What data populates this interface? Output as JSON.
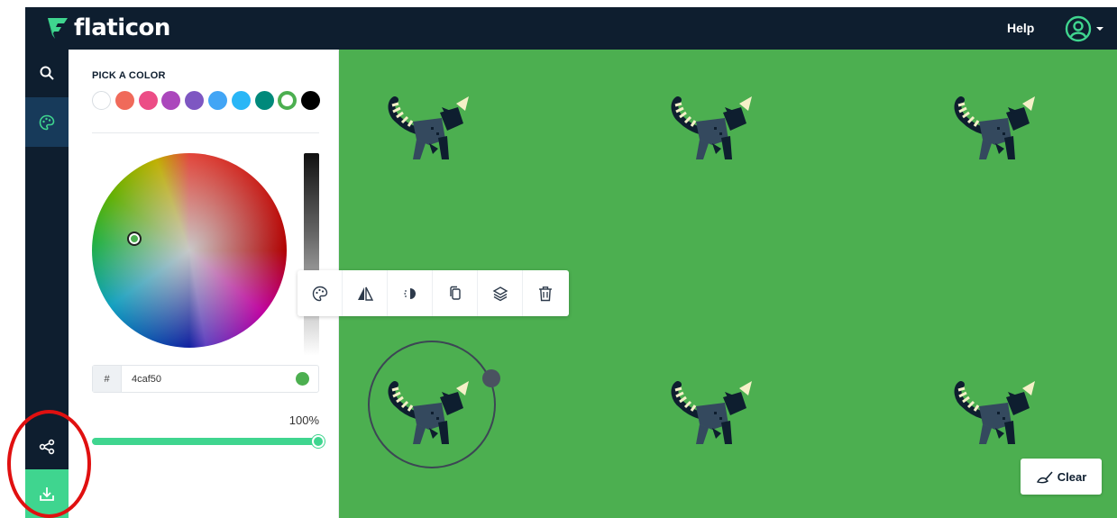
{
  "header": {
    "logo_text": "flaticon",
    "help_label": "Help",
    "user_icon": "user-circle-icon",
    "colors": {
      "bar": "#0e1e2f",
      "logo_mark": "#3fd58f"
    }
  },
  "sidebar": {
    "items": [
      {
        "name": "search",
        "icon": "search-icon"
      },
      {
        "name": "color",
        "icon": "palette-icon",
        "active": true
      },
      {
        "name": "share",
        "icon": "share-icon"
      },
      {
        "name": "download",
        "icon": "download-icon"
      }
    ]
  },
  "color_panel": {
    "title": "PICK A COLOR",
    "swatches": [
      "#ffffff",
      "#f06a5a",
      "#ec4d86",
      "#ab47bc",
      "#7e57c2",
      "#42a5f5",
      "#29b6f6",
      "#00897b",
      "#4caf50",
      "#000000"
    ],
    "selected_swatch": "#4caf50",
    "hex_prefix": "#",
    "hex_value": "4caf50",
    "opacity_label": "100%",
    "opacity": 1.0
  },
  "toolbar": {
    "tools": [
      "palette-icon",
      "flip-icon",
      "contrast-icon",
      "duplicate-icon",
      "layers-icon",
      "delete-icon"
    ]
  },
  "canvas": {
    "background": "#4caf50",
    "clear_label": "Clear"
  },
  "annotation": {
    "color": "#e01010"
  }
}
